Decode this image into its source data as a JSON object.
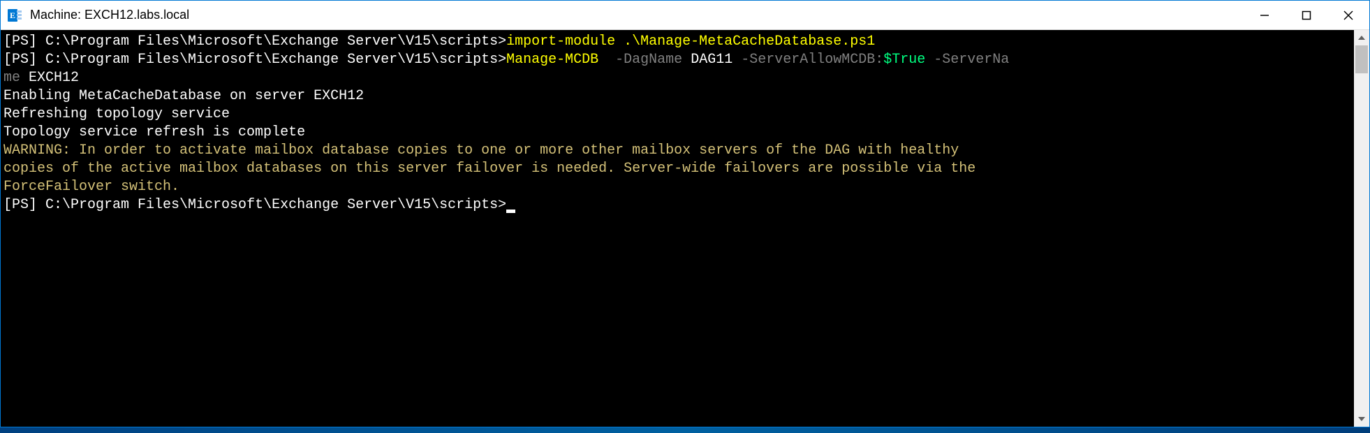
{
  "window": {
    "title": "Machine: EXCH12.labs.local",
    "icon_letter": "E"
  },
  "terminal": {
    "lines": [
      {
        "segments": [
          {
            "text": "[PS] ",
            "class": "ps-white"
          },
          {
            "text": "C:\\Program Files\\Microsoft\\Exchange Server\\V15\\scripts>",
            "class": "ps-white"
          },
          {
            "text": "import-module .\\Manage-MetaCacheDatabase.ps1",
            "class": "ps-yellow"
          }
        ]
      },
      {
        "segments": [
          {
            "text": "[PS] ",
            "class": "ps-white"
          },
          {
            "text": "C:\\Program Files\\Microsoft\\Exchange Server\\V15\\scripts>",
            "class": "ps-white"
          },
          {
            "text": "Manage-MCDB ",
            "class": "ps-yellow"
          },
          {
            "text": " -DagName ",
            "class": "ps-gray"
          },
          {
            "text": "DAG11",
            "class": "ps-white"
          },
          {
            "text": " -ServerAllowMCDB:",
            "class": "ps-gray"
          },
          {
            "text": "$True",
            "class": "ps-green"
          },
          {
            "text": " -ServerNa",
            "class": "ps-gray"
          }
        ]
      },
      {
        "segments": [
          {
            "text": "me ",
            "class": "ps-gray"
          },
          {
            "text": "EXCH12",
            "class": "ps-white"
          }
        ]
      },
      {
        "segments": [
          {
            "text": "Enabling MetaCacheDatabase on server EXCH12",
            "class": "ps-white"
          }
        ]
      },
      {
        "segments": [
          {
            "text": "Refreshing topology service",
            "class": "ps-white"
          }
        ]
      },
      {
        "segments": [
          {
            "text": "Topology service refresh is complete",
            "class": "ps-white"
          }
        ]
      },
      {
        "segments": [
          {
            "text": "WARNING: In order to activate mailbox database copies to one or more other mailbox servers of the DAG with healthy",
            "class": "ps-warn"
          }
        ]
      },
      {
        "segments": [
          {
            "text": "copies of the active mailbox databases on this server failover is needed. Server-wide failovers are possible via the",
            "class": "ps-warn"
          }
        ]
      },
      {
        "segments": [
          {
            "text": "ForceFailover switch.",
            "class": "ps-warn"
          }
        ]
      },
      {
        "segments": [
          {
            "text": "[PS] ",
            "class": "ps-white"
          },
          {
            "text": "C:\\Program Files\\Microsoft\\Exchange Server\\V15\\scripts>",
            "class": "ps-white"
          }
        ],
        "cursor": true
      }
    ]
  }
}
